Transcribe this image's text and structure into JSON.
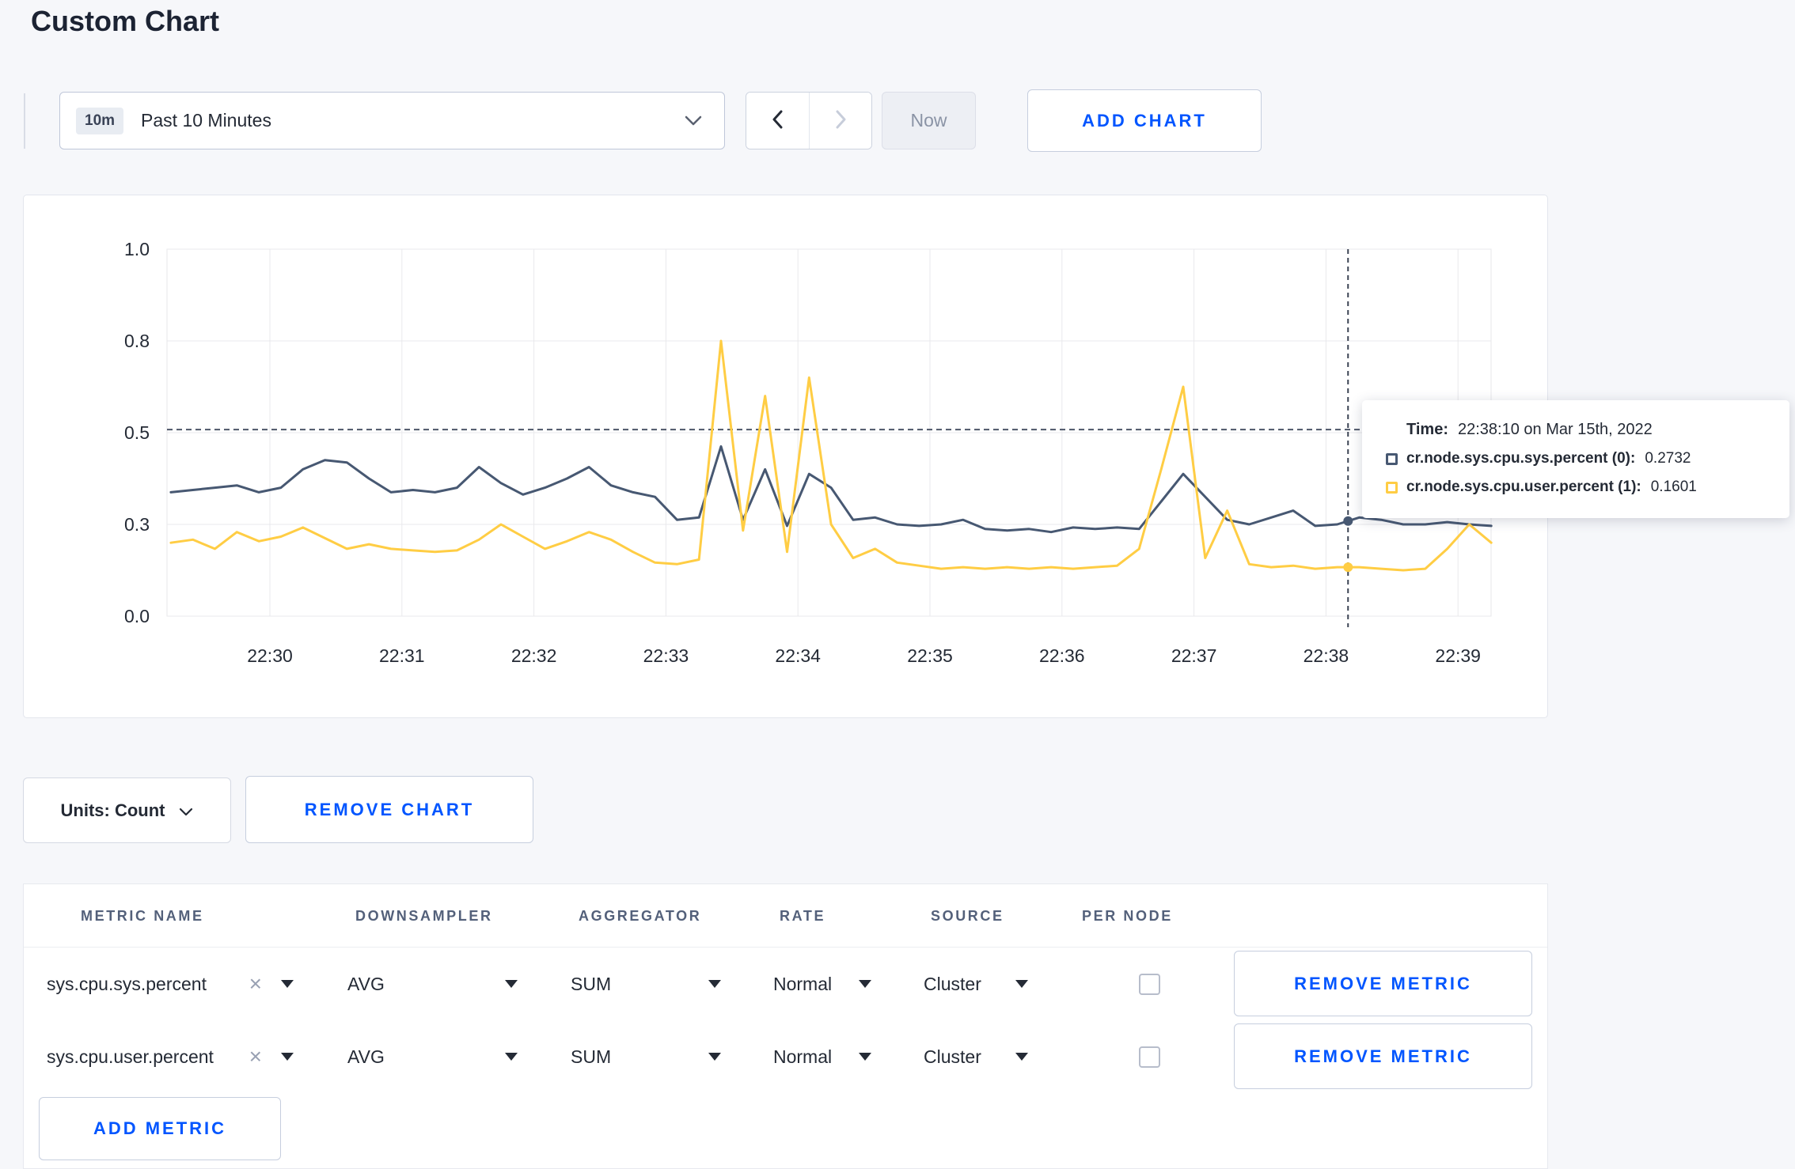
{
  "page": {
    "title": "Custom Chart"
  },
  "colors": {
    "accent_blue": "#0055ff",
    "series_sys": "#475872",
    "series_user": "#ffcd44",
    "page_background": "#f6f7fa"
  },
  "toolbar": {
    "time_window_badge": "10m",
    "time_window_label": "Past 10 Minutes",
    "now_label": "Now",
    "add_chart_label": "ADD CHART"
  },
  "chart_data": {
    "type": "line",
    "title": "",
    "xlabel": "",
    "ylabel": "",
    "x_ticks": [
      "22:30",
      "22:31",
      "22:32",
      "22:33",
      "22:34",
      "22:35",
      "22:36",
      "22:37",
      "22:38",
      "22:39"
    ],
    "y_ticks": [
      0.0,
      0.3,
      0.5,
      0.8,
      1.0
    ],
    "y_tick_labels": [
      "0.0",
      "0.3",
      "0.5",
      "0.8",
      "1.0"
    ],
    "grid": true,
    "threshold_value": 0.51,
    "cursor_x": 8.167,
    "cursor_time": "22:38:10",
    "series": [
      {
        "name": "cr.node.sys.cpu.sys.percent",
        "color": "#475872",
        "x_start": -0.75,
        "x_step": 0.1667,
        "values": [
          0.37,
          0.375,
          0.38,
          0.385,
          0.37,
          0.38,
          0.42,
          0.44,
          0.435,
          0.4,
          0.37,
          0.375,
          0.37,
          0.38,
          0.425,
          0.39,
          0.365,
          0.38,
          0.4,
          0.425,
          0.385,
          0.37,
          0.36,
          0.31,
          0.315,
          0.47,
          0.31,
          0.42,
          0.295,
          0.41,
          0.38,
          0.31,
          0.315,
          0.3,
          0.295,
          0.3,
          0.31,
          0.285,
          0.28,
          0.285,
          0.275,
          0.29,
          0.285,
          0.29,
          0.285,
          0.35,
          0.41,
          0.36,
          0.31,
          0.3,
          0.315,
          0.33,
          0.295,
          0.3,
          0.315,
          0.31,
          0.3,
          0.3,
          0.305,
          0.3,
          0.295
        ]
      },
      {
        "name": "cr.node.sys.cpu.user.percent",
        "color": "#ffcd44",
        "x_start": -0.75,
        "x_step": 0.1667,
        "values": [
          0.24,
          0.25,
          0.22,
          0.275,
          0.245,
          0.26,
          0.29,
          0.255,
          0.22,
          0.235,
          0.22,
          0.215,
          0.21,
          0.215,
          0.25,
          0.3,
          0.26,
          0.22,
          0.245,
          0.275,
          0.25,
          0.21,
          0.175,
          0.17,
          0.185,
          0.8,
          0.28,
          0.62,
          0.21,
          0.68,
          0.3,
          0.19,
          0.22,
          0.175,
          0.165,
          0.155,
          0.16,
          0.155,
          0.16,
          0.155,
          0.16,
          0.155,
          0.16,
          0.165,
          0.22,
          0.42,
          0.65,
          0.19,
          0.33,
          0.17,
          0.16,
          0.165,
          0.155,
          0.16,
          0.16,
          0.155,
          0.15,
          0.155,
          0.22,
          0.3,
          0.24
        ]
      }
    ]
  },
  "tooltip": {
    "time_label": "Time:",
    "time_value": "22:38:10 on Mar 15th, 2022",
    "series": [
      {
        "label": "cr.node.sys.cpu.sys.percent (0):",
        "value": "0.2732",
        "color": "#475872"
      },
      {
        "label": "cr.node.sys.cpu.user.percent (1):",
        "value": "0.1601",
        "color": "#ffcd44"
      }
    ]
  },
  "chart_controls": {
    "units_label": "Units: Count",
    "remove_chart_label": "REMOVE CHART"
  },
  "metrics_table": {
    "headers": [
      "METRIC NAME",
      "DOWNSAMPLER",
      "AGGREGATOR",
      "RATE",
      "SOURCE",
      "PER NODE"
    ],
    "clear_icon": "×",
    "rows": [
      {
        "metric": "sys.cpu.sys.percent",
        "downsampler": "AVG",
        "aggregator": "SUM",
        "rate": "Normal",
        "source": "Cluster",
        "per_node": false,
        "remove_label": "REMOVE METRIC"
      },
      {
        "metric": "sys.cpu.user.percent",
        "downsampler": "AVG",
        "aggregator": "SUM",
        "rate": "Normal",
        "source": "Cluster",
        "per_node": false,
        "remove_label": "REMOVE METRIC"
      }
    ],
    "add_metric_label": "ADD METRIC"
  }
}
